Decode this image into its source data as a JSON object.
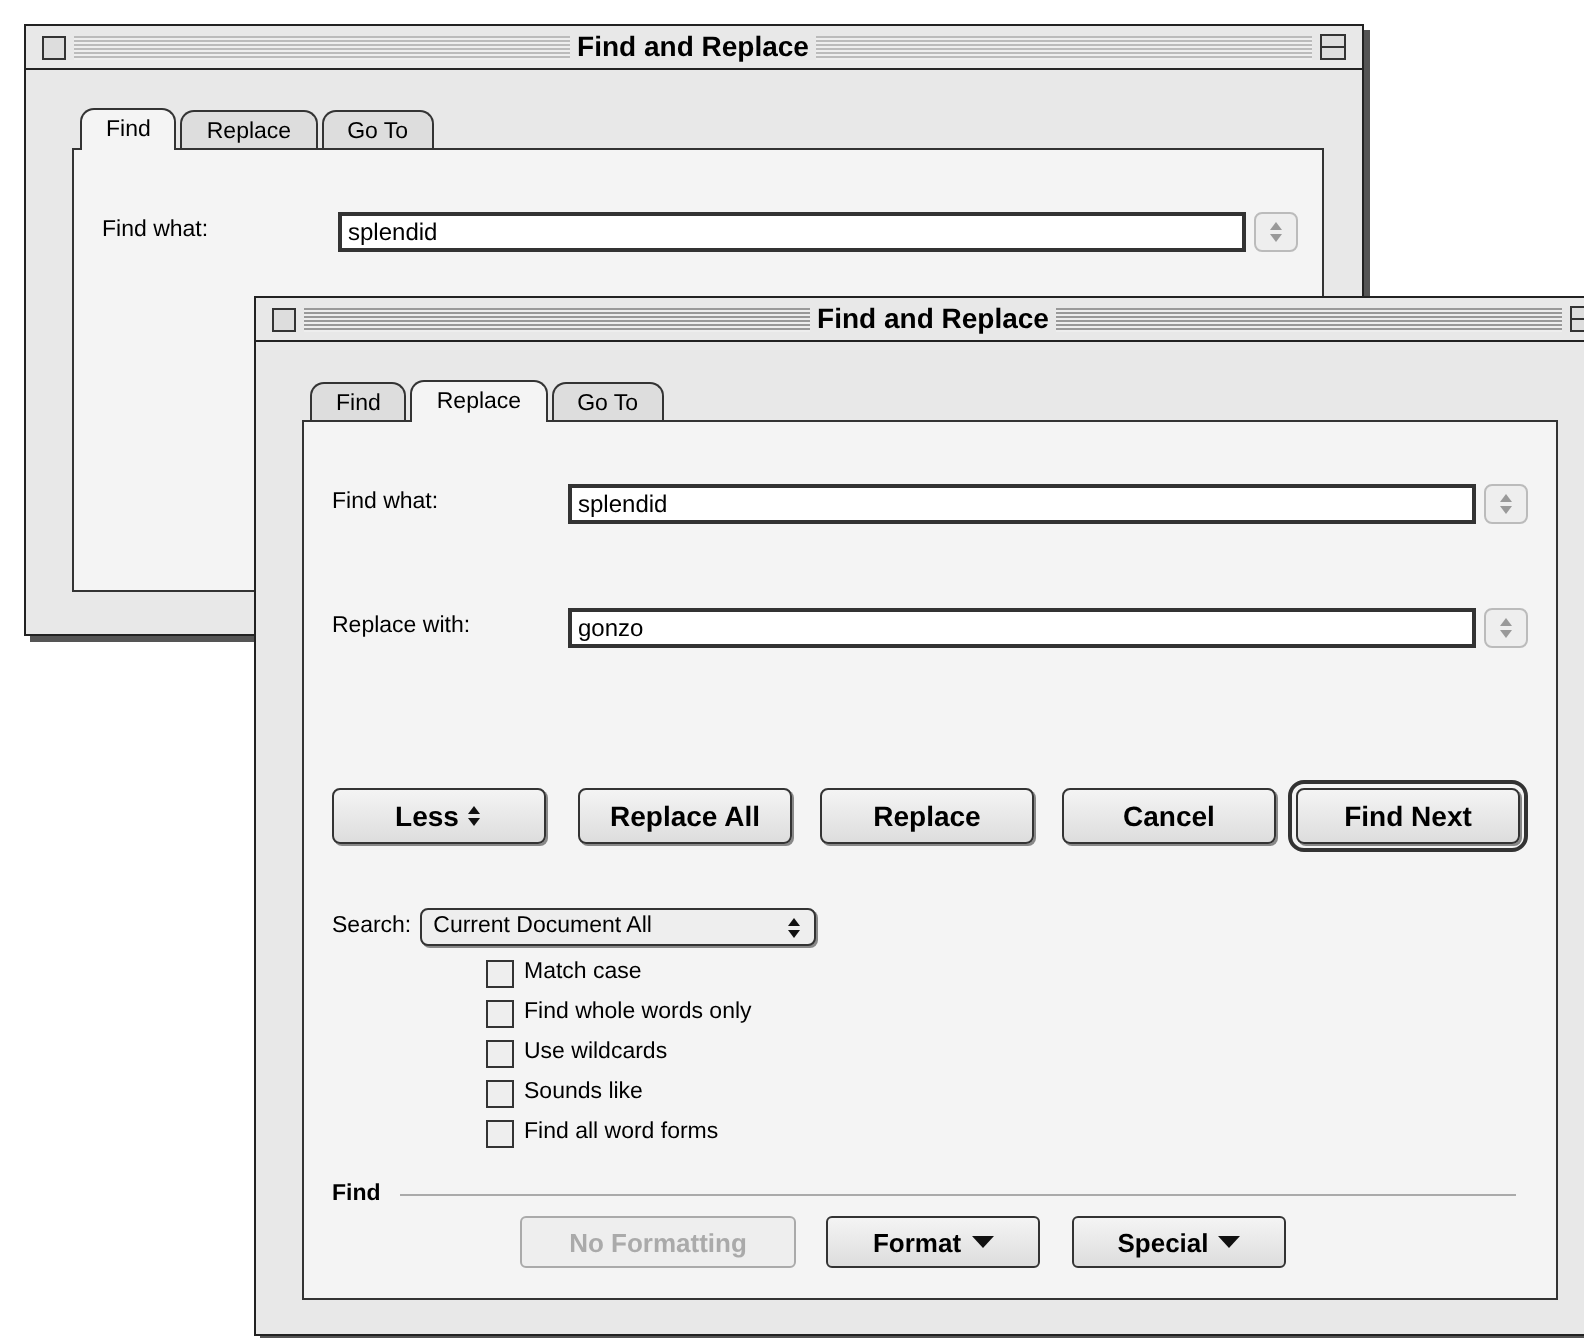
{
  "windows": [
    {
      "title": "Find and Replace",
      "active": false,
      "tabs": [
        {
          "label": "Find",
          "selected": true
        },
        {
          "label": "Replace",
          "selected": false
        },
        {
          "label": "Go To",
          "selected": false
        }
      ],
      "fields": [
        {
          "label": "Find what:",
          "value": "splendid"
        }
      ]
    },
    {
      "title": "Find and Replace",
      "active": true,
      "tabs": [
        {
          "label": "Find",
          "selected": false
        },
        {
          "label": "Replace",
          "selected": true
        },
        {
          "label": "Go To",
          "selected": false
        }
      ],
      "fields": [
        {
          "label": "Find what:",
          "value": "splendid"
        },
        {
          "label": "Replace with:",
          "value": "gonzo"
        }
      ],
      "buttons": [
        {
          "label": "Less",
          "kind": "toggle",
          "default": false
        },
        {
          "label": "Replace All",
          "kind": "plain",
          "default": false
        },
        {
          "label": "Replace",
          "kind": "plain",
          "default": false
        },
        {
          "label": "Cancel",
          "kind": "plain",
          "default": false
        },
        {
          "label": "Find Next",
          "kind": "plain",
          "default": true
        }
      ],
      "search": {
        "label": "Search:",
        "value": "Current Document All"
      },
      "options": [
        {
          "label": "Match case",
          "checked": false
        },
        {
          "label": "Find whole words only",
          "checked": false
        },
        {
          "label": "Use wildcards",
          "checked": false
        },
        {
          "label": "Sounds like",
          "checked": false
        },
        {
          "label": "Find all word forms",
          "checked": false
        }
      ],
      "section": {
        "title": "Find",
        "buttons": [
          {
            "label": "No Formatting",
            "kind": "plain",
            "disabled": true
          },
          {
            "label": "Format",
            "kind": "menu",
            "disabled": false
          },
          {
            "label": "Special",
            "kind": "menu",
            "disabled": false
          }
        ]
      }
    }
  ]
}
